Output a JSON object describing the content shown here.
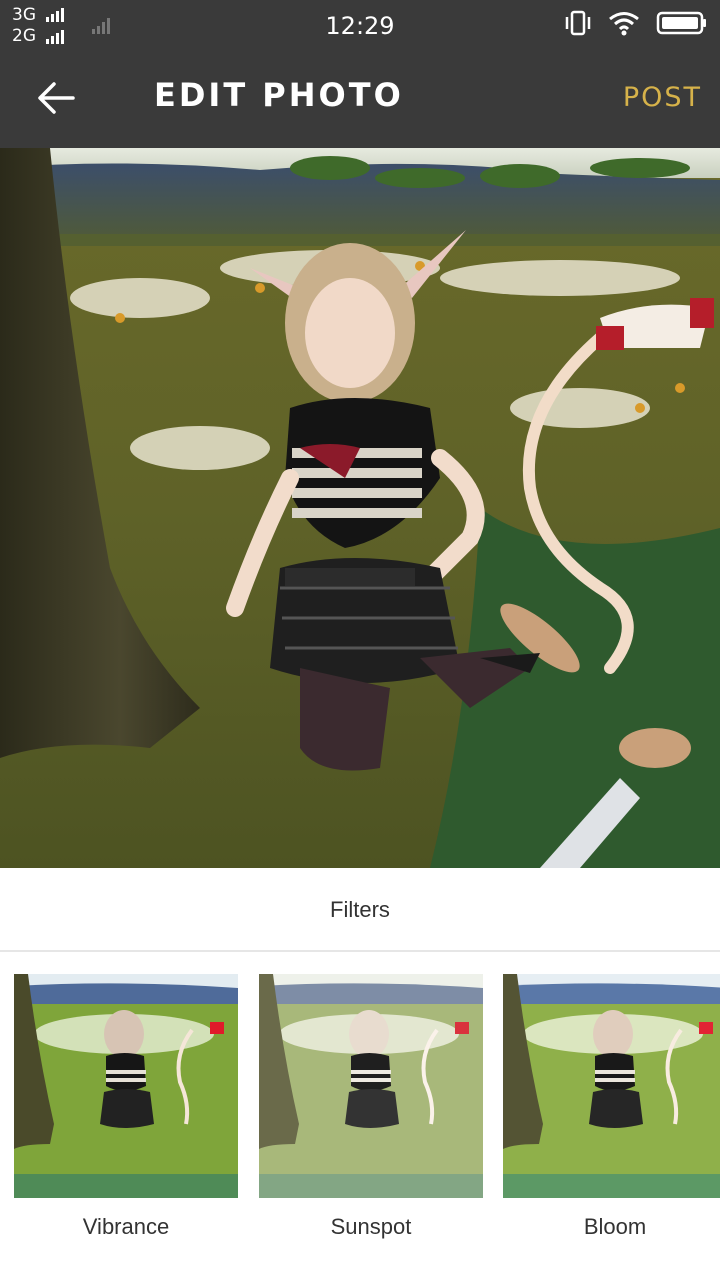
{
  "status_bar": {
    "network_1": "3G",
    "network_2": "2G",
    "time": "12:29",
    "icons": [
      "vibrate-icon",
      "wifi-icon",
      "battery-icon"
    ]
  },
  "app_bar": {
    "title": "EDIT PHOTO",
    "post_label": "POST",
    "post_color": "#d6b24a",
    "back_icon": "arrow-left-icon"
  },
  "filters": {
    "heading": "Filters",
    "items": [
      {
        "label": "Vibrance"
      },
      {
        "label": "Sunspot"
      },
      {
        "label": "Bloom"
      }
    ]
  },
  "colors": {
    "bar_bg": "#3a3a3a",
    "accent": "#d6b24a"
  }
}
